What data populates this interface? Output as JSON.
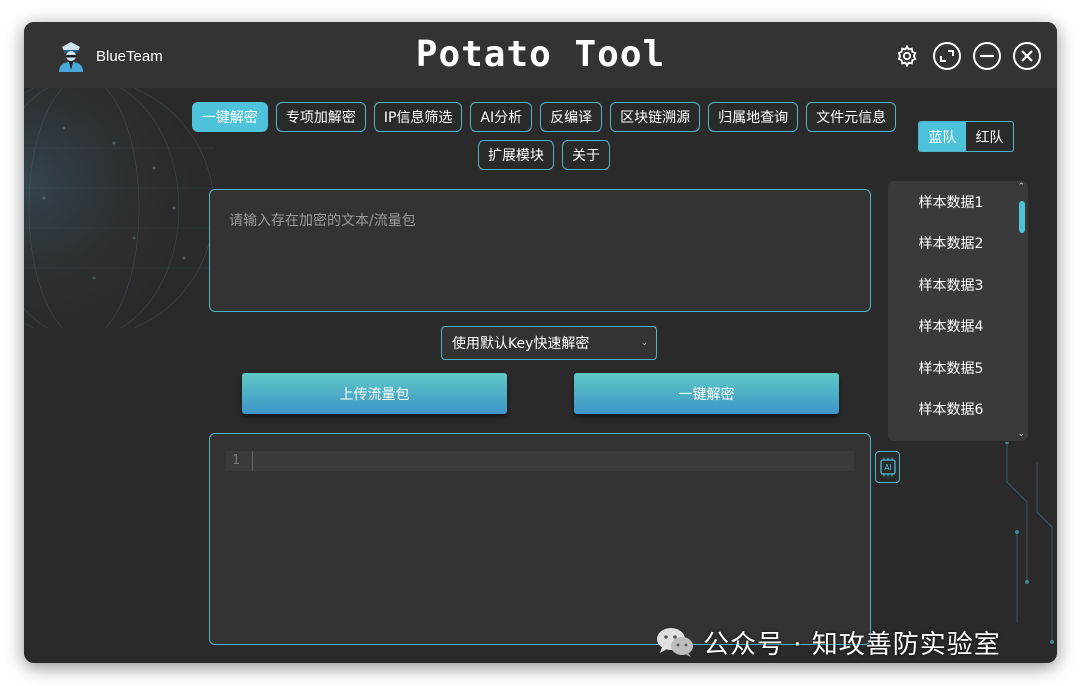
{
  "window": {
    "brand_name": "BlueTeam",
    "app_title": "Potato Tool"
  },
  "window_controls": {
    "icons": [
      "gear-icon",
      "expand-icon",
      "minimize-icon",
      "close-icon"
    ]
  },
  "nav": {
    "row1": [
      "一键解密",
      "专项加解密",
      "IP信息筛选",
      "AI分析",
      "反编译",
      "区块链溯源",
      "归属地查询",
      "文件元信息"
    ],
    "row2": [
      "扩展模块",
      "关于"
    ],
    "active": "一键解密"
  },
  "team_toggle": {
    "blue": "蓝队",
    "red": "红队",
    "active": "蓝队"
  },
  "sample_list": {
    "items": [
      "样本数据1",
      "样本数据2",
      "样本数据3",
      "样本数据4",
      "样本数据5",
      "样本数据6"
    ]
  },
  "input": {
    "placeholder": "请输入存在加密的文本/流量包"
  },
  "key_select": {
    "selected": "使用默认Key快速解密"
  },
  "buttons": {
    "upload": "上传流量包",
    "decrypt": "一键解密"
  },
  "editor": {
    "line_number": "1",
    "ai_label": "AI"
  },
  "watermark": {
    "text": "公众号 · 知攻善防实验室"
  },
  "colors": {
    "accent": "#4ec2da",
    "background": "#2a2a2a",
    "titlebar": "#333333"
  }
}
